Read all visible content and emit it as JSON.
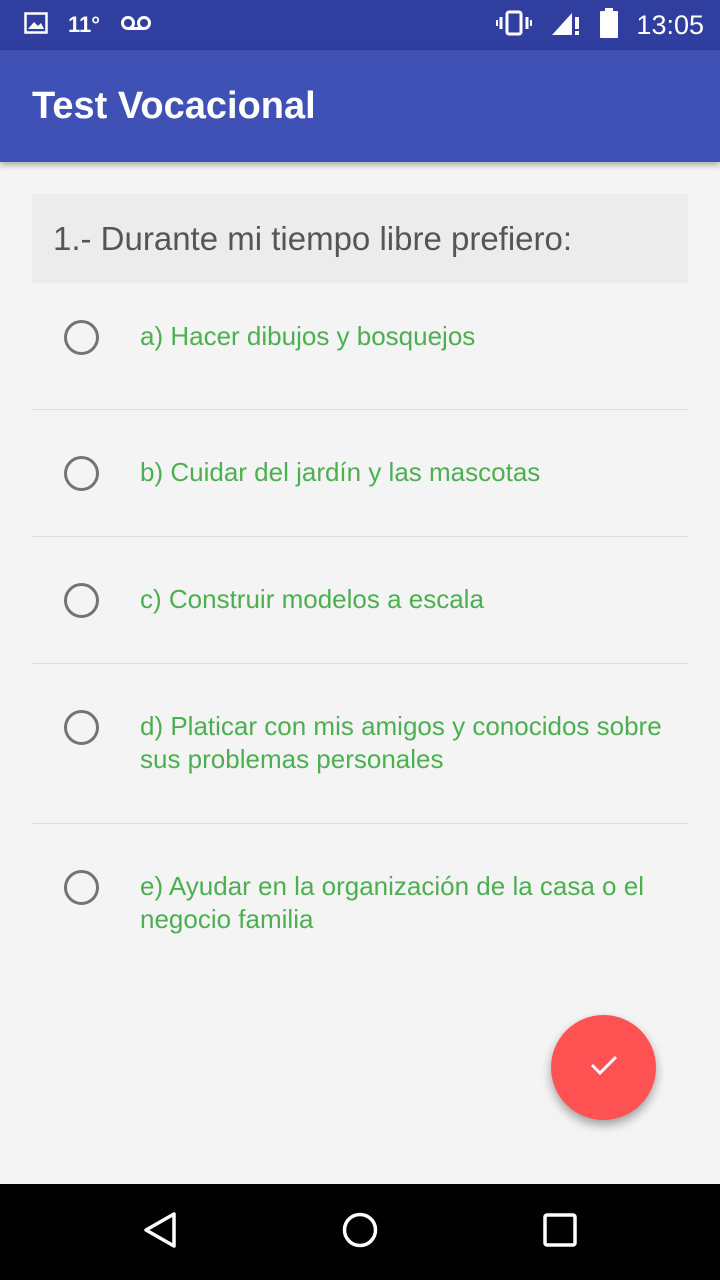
{
  "status_bar": {
    "temperature": "11°",
    "time": "13:05",
    "icons": [
      "image-icon",
      "voicemail-icon",
      "vibrate-icon",
      "signal-icon",
      "battery-icon"
    ]
  },
  "app_bar": {
    "title": "Test Vocacional",
    "color": "#3f51b5"
  },
  "question": {
    "text": "1.- Durante mi tiempo libre prefiero:",
    "options": [
      {
        "label": "a) Hacer dibujos y bosquejos",
        "selected": false
      },
      {
        "label": "b) Cuidar del jardín y las mascotas",
        "selected": false
      },
      {
        "label": "c) Construir modelos a escala",
        "selected": false
      },
      {
        "label": "d) Platicar con mis amigos y conocidos sobre sus problemas personales",
        "selected": false
      },
      {
        "label": "e) Ayudar en la organización de la casa o el negocio familia",
        "selected": false
      }
    ],
    "option_color": "#4caf50"
  },
  "fab": {
    "icon": "check-icon",
    "color": "#ff5252"
  },
  "nav_bar": {
    "buttons": [
      "back-icon",
      "home-icon",
      "recents-icon"
    ]
  }
}
